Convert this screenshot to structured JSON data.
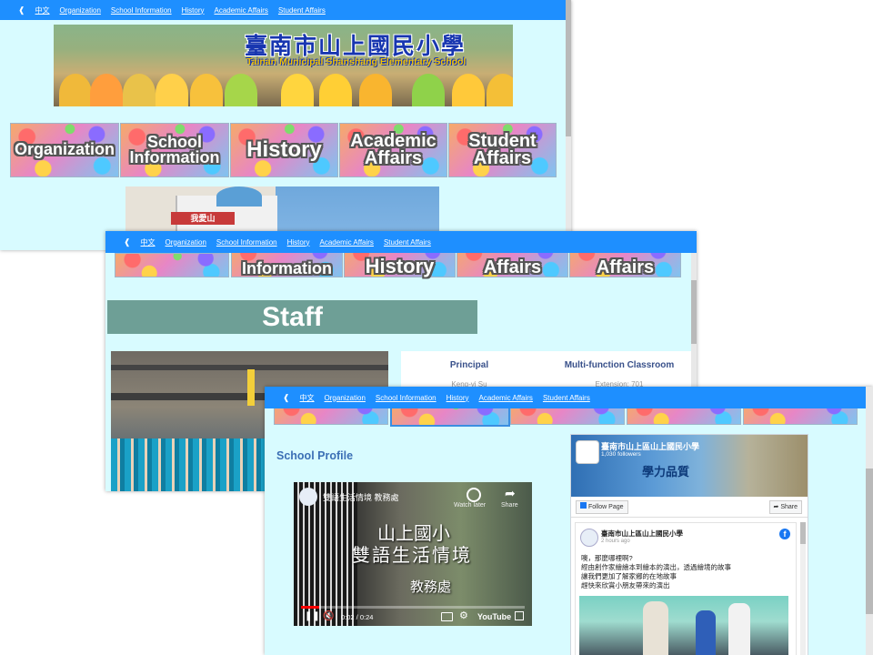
{
  "nav": {
    "home_icon": "home-icon",
    "items": [
      "中文",
      "Organization",
      "School Information",
      "History",
      "Academic Affairs",
      "Student Affairs"
    ]
  },
  "banner": {
    "title_zh": "臺南市山上國民小學",
    "title_en": "Tainan Municipal Shanshang Elementary School"
  },
  "tiles": [
    [
      "Organization"
    ],
    [
      "School",
      "Information"
    ],
    [
      "History"
    ],
    [
      "Academic",
      "Affairs"
    ],
    [
      "Student",
      "Affairs"
    ]
  ],
  "staff": {
    "heading": "Staff",
    "cards": [
      {
        "title": "Principal",
        "name": "Keng-yi Su"
      },
      {
        "title": "Multi-function Classroom",
        "name": "Extension: 701"
      }
    ],
    "photo_sign": "我愛山"
  },
  "profile": {
    "heading": "School Profile",
    "video": {
      "title": "雙語生活情境 教務處",
      "watch_later": "Watch later",
      "share": "Share",
      "caption_line1": "山上國小",
      "caption_line2": "雙語生活情境",
      "caption_line3": "教務處",
      "time": "0:02 / 0:24",
      "brand": "YouTube",
      "progress": 0.083
    },
    "facebook": {
      "page_name": "臺南市山上區山上國民小學",
      "followers": "1,030 followers",
      "cover_text": "學力品質",
      "follow_label": "Follow Page",
      "share_label": "Share",
      "post_author": "臺南市山上區山上國民小學",
      "post_time": "2 hours ago",
      "post_lines": [
        "噢，那麼哪裡啊?",
        "經由創作家繪繪本到繪本的演出，透過繪境的故事",
        "讓我們更加了解家鄉的在地故事",
        "趕快來欣賞小朋友帶來的演出"
      ]
    }
  },
  "colors": {
    "nav": "#1e8fff",
    "page_bg": "#d8fbff",
    "staff_bar": "#6e9f96",
    "heading": "#3b6fb5"
  }
}
